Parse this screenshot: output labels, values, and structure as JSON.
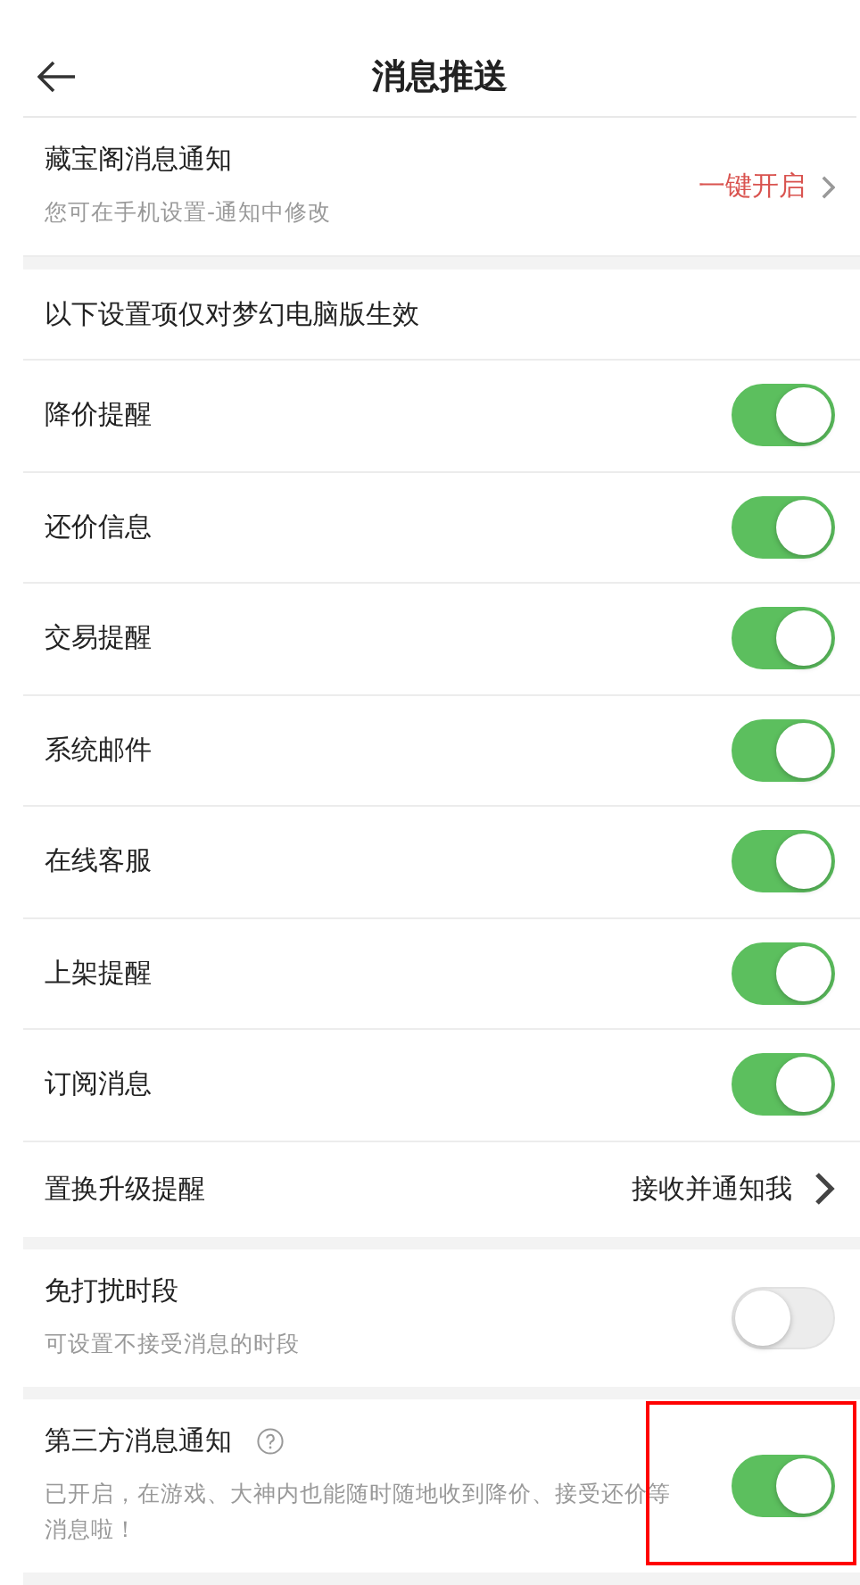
{
  "header": {
    "title": "消息推送"
  },
  "app_notice": {
    "title": "藏宝阁消息通知",
    "subtitle": "您可在手机设置-通知中修改",
    "action": "一键开启"
  },
  "section_note": "以下设置项仅对梦幻电脑版生效",
  "settings": [
    {
      "kind": "toggle",
      "label": "降价提醒",
      "on": true
    },
    {
      "kind": "toggle",
      "label": "还价信息",
      "on": true
    },
    {
      "kind": "toggle",
      "label": "交易提醒",
      "on": true
    },
    {
      "kind": "toggle",
      "label": "系统邮件",
      "on": true
    },
    {
      "kind": "toggle",
      "label": "在线客服",
      "on": true
    },
    {
      "kind": "toggle",
      "label": "上架提醒",
      "on": true
    },
    {
      "kind": "toggle",
      "label": "订阅消息",
      "on": true
    },
    {
      "kind": "link",
      "label": "置换升级提醒",
      "value": "接收并通知我"
    }
  ],
  "extra_settings": [
    {
      "title": "免打扰时段",
      "description": "可设置不接受消息的时段",
      "on": false,
      "help": false,
      "highlighted": false
    },
    {
      "title": "第三方消息通知",
      "description": "已开启，在游戏、大神内也能随时随地收到降价、接受还价等消息啦！",
      "on": true,
      "help": true,
      "highlighted": true
    }
  ]
}
